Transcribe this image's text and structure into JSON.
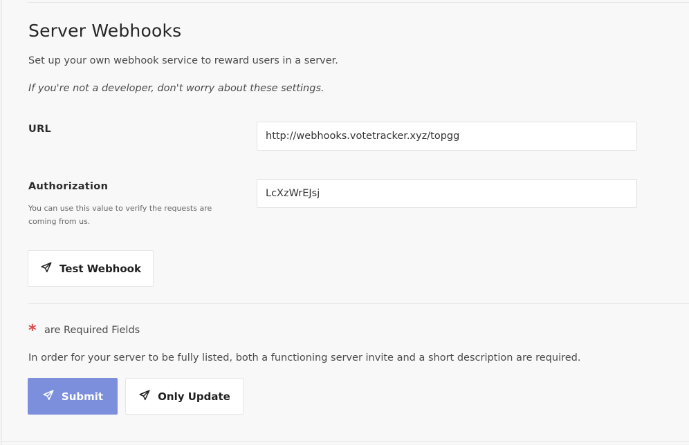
{
  "section": {
    "title": "Server Webhooks",
    "subtitle": "Set up your own webhook service to reward users in a server.",
    "note": "If you're not a developer, don't worry about these settings."
  },
  "url_field": {
    "label": "URL",
    "value": "http://webhooks.votetracker.xyz/topgg"
  },
  "auth_field": {
    "label": "Authorization",
    "help": "You can use this value to verify the requests are coming from us.",
    "value": "LcXzWrEJsj"
  },
  "test_button": {
    "label": "Test Webhook",
    "icon": "paper-plane-icon"
  },
  "required": {
    "star": "*",
    "text": "are Required Fields"
  },
  "listing_note": "In order for your server to be fully listed, both a functioning server invite and a short description are required.",
  "actions": {
    "submit_label": "Submit",
    "update_label": "Only Update"
  },
  "colors": {
    "primary": "#7b8fdd",
    "required": "#e0474c"
  }
}
